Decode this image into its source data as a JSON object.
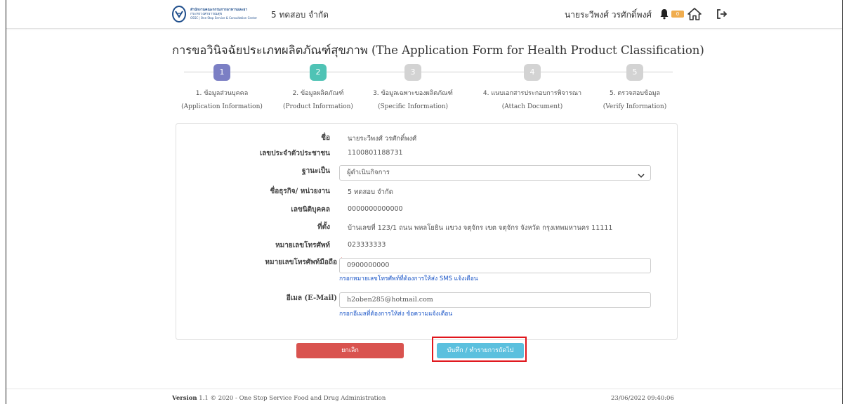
{
  "header": {
    "logo": {
      "line1": "สำนักงานคณะกรรมการอาหารและยา",
      "line2": "กระทรวงสาธารณสุข",
      "line3": "OSSC | One Stop Service & Consultation Center"
    },
    "org_name": "5 ทดสอบ จำกัด",
    "user_name": "นายระวีพงศ์ วรศักดิ์พงศ์",
    "notification_count": "0"
  },
  "page_title": "การขอวินิจฉัยประเภทผลิตภัณฑ์สุขภาพ (The Application Form for Health Product Classification)",
  "steps": [
    {
      "num": "1",
      "label": "1. ข้อมูลส่วนบุคคล",
      "sub": "(Application Information)",
      "color": "#7b7fc4"
    },
    {
      "num": "2",
      "label": "2. ข้อมูลผลิตภัณฑ์",
      "sub": "(Product Information)",
      "color": "#4fc3b5"
    },
    {
      "num": "3",
      "label": "3. ข้อมูลเฉพาะของผลิตภัณฑ์",
      "sub": "(Specific Information)",
      "color": "#d3d3d3"
    },
    {
      "num": "4",
      "label": "4. แนบเอกสารประกอบการพิจารณา",
      "sub": "(Attach Document)",
      "color": "#d3d3d3"
    },
    {
      "num": "5",
      "label": "5. ตรวจสอบข้อมูล",
      "sub": "(Verify Information)",
      "color": "#d3d3d3"
    }
  ],
  "form": {
    "name_label": "ชื่อ",
    "name_value": "นายระวีพงศ์ วรศักดิ์พงศ์",
    "id_label": "เลขประจำตัวประชาชน",
    "id_value": "1100801188731",
    "status_label": "ฐานะเป็น",
    "status_value": "ผู้ดำเนินกิจการ",
    "business_label": "ชื่อธุรกิจ/ หน่วยงาน",
    "business_value": "5 ทดสอบ จำกัด",
    "juristic_label": "เลขนิติบุคคล",
    "juristic_value": "0000000000000",
    "address_label": "ที่ตั้ง",
    "address_value": "บ้านเลขที่ 123/1 ถนน พหลโยธิน แขวง จตุจักร เขต จตุจักร จังหวัด กรุงเทพมหานคร 11111",
    "phone_label": "หมายเลขโทรศัพท์",
    "phone_value": "023333333",
    "mobile_label": "หมายเลขโทรศัพท์มือถือ",
    "mobile_value": "0900000000",
    "mobile_hint": "กรอกหมายเลขโทรศัพท์ที่ต้องการให้ส่ง SMS แจ้งเตือน",
    "email_label": "อีเมล (E-Mail)",
    "email_value": "h2oben285@hotmail.com",
    "email_hint": "กรอกอีเมลที่ต้องการให้ส่ง ข้อความแจ้งเตือน",
    "required_mark": "*"
  },
  "actions": {
    "cancel_label": "ยกเลิก",
    "save_label": "บันทึก / ทำรายการถัดไป"
  },
  "footer": {
    "version_label": "Version",
    "version_text": "1.1 © 2020 - One Stop Service Food and Drug Administration",
    "datetime": "23/06/2022 09:40:06"
  }
}
